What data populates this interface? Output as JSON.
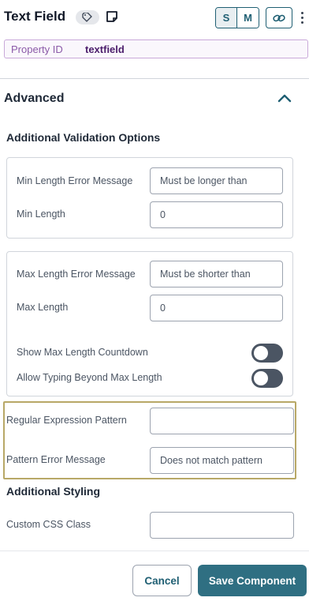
{
  "header": {
    "title": "Text Field",
    "size_options": [
      "S",
      "M"
    ],
    "selected_size": "S"
  },
  "property": {
    "label": "Property ID",
    "value": "textfield"
  },
  "section": {
    "title": "Advanced",
    "expanded": true
  },
  "validation": {
    "title": "Additional Validation Options",
    "min_length_error_label": "Min Length Error Message",
    "min_length_error_value": "Must be longer than",
    "min_length_label": "Min Length",
    "min_length_value": "0",
    "max_length_error_label": "Max Length Error Message",
    "max_length_error_value": "Must be shorter than",
    "max_length_label": "Max Length",
    "max_length_value": "0",
    "show_countdown_label": "Show Max Length Countdown",
    "show_countdown_on": false,
    "allow_typing_label": "Allow Typing Beyond Max Length",
    "allow_typing_on": false,
    "regex_label": "Regular Expression Pattern",
    "regex_value": "",
    "pattern_error_label": "Pattern Error Message",
    "pattern_error_value": "Does not match pattern"
  },
  "styling": {
    "title": "Additional Styling",
    "css_class_label": "Custom CSS Class",
    "css_class_value": ""
  },
  "footer": {
    "cancel_label": "Cancel",
    "save_label": "Save Component"
  },
  "colors": {
    "accent": "#2f6f82",
    "highlight_border": "#b8a867",
    "property_border": "#c9a9d9"
  },
  "icons": [
    "tag-icon",
    "note-icon",
    "link-icon",
    "more-vertical-icon",
    "chevron-up-icon"
  ]
}
